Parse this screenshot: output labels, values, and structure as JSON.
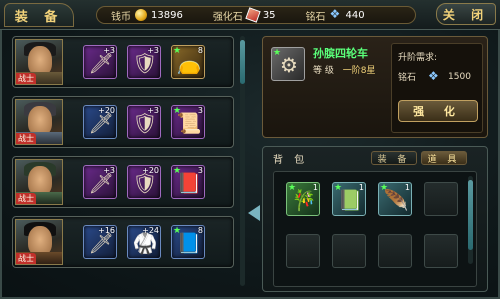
{
  "header": {
    "title": "装 备",
    "close_label": "关 闭",
    "currencies": [
      {
        "label": "钱币",
        "value": "13896",
        "icon": "coin-icon"
      },
      {
        "label": "强化石",
        "value": "35",
        "icon": "enhance-stone-icon"
      },
      {
        "label": "铭石",
        "value": "440",
        "icon": "inscription-stone-icon"
      }
    ]
  },
  "heroes": [
    {
      "badge": "战士",
      "slots": [
        {
          "level": "+3",
          "icon": "sword-icon",
          "quality": "purple"
        },
        {
          "level": "+3",
          "icon": "armor-icon",
          "quality": "purple"
        },
        {
          "level": "8",
          "icon": "pouch-icon",
          "quality": "gold"
        }
      ]
    },
    {
      "badge": "战士",
      "slots": [
        {
          "level": "+20",
          "icon": "sword-icon",
          "quality": "blue"
        },
        {
          "level": "+3",
          "icon": "armor-icon",
          "quality": "purple"
        },
        {
          "level": "3",
          "icon": "scroll-icon",
          "quality": "purple"
        }
      ]
    },
    {
      "badge": "战士",
      "slots": [
        {
          "level": "+3",
          "icon": "sword-icon",
          "quality": "purple"
        },
        {
          "level": "+20",
          "icon": "armor-icon",
          "quality": "purple"
        },
        {
          "level": "3",
          "icon": "book-icon",
          "quality": "purple"
        }
      ]
    },
    {
      "badge": "战士",
      "slots": [
        {
          "level": "+16",
          "icon": "sword-icon",
          "quality": "blue"
        },
        {
          "level": "+24",
          "icon": "armor-icon",
          "quality": "blue"
        },
        {
          "level": "8",
          "icon": "book-icon",
          "quality": "blue"
        }
      ]
    }
  ],
  "detail": {
    "name": "孙膑四轮车",
    "grade_label": "等 级",
    "grade_value": "一阶8星",
    "req_title": "升阶需求:",
    "req_item": "铭石",
    "req_value": "1500",
    "upgrade_label": "强 化"
  },
  "bag": {
    "title": "背 包",
    "tabs": [
      "装 备",
      "道 具"
    ],
    "items": [
      {
        "icon": "bamboo-icon",
        "quality": "green",
        "count": "1"
      },
      {
        "icon": "book-icon",
        "quality": "teal",
        "count": "1"
      },
      {
        "icon": "wing-icon",
        "quality": "teal",
        "count": "1"
      }
    ]
  }
}
